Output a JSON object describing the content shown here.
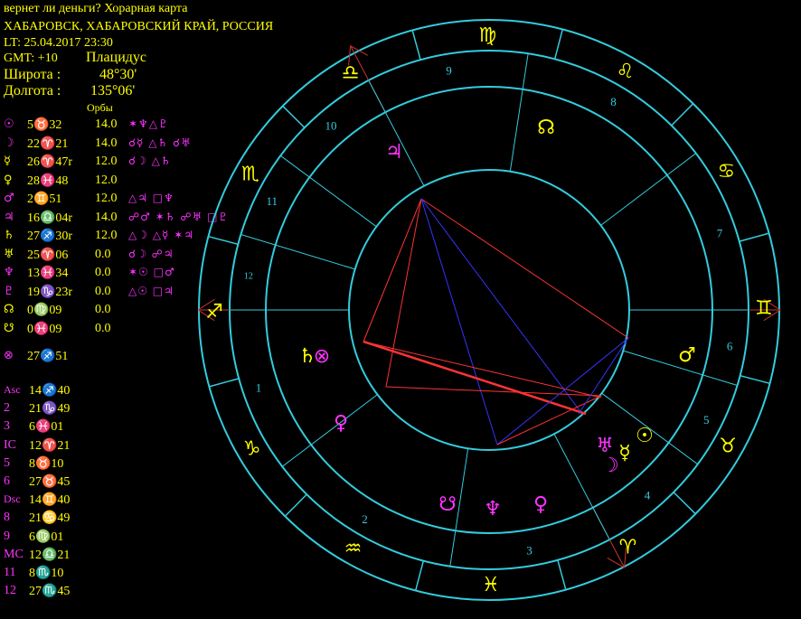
{
  "header": {
    "title": "вернет ли деньги? Хорарная карта",
    "place": "ХАБАРОВСК, ХАБАРОВСКИЙ КРАЙ, РОССИЯ",
    "lt": "LT: 25.04.2017  23:30",
    "gmt": "GMT: +10",
    "system": "Плацидус",
    "lat_label": "Широта :",
    "lat_value": "48°30'",
    "lon_label": "Долгота :",
    "lon_value": "135°06'",
    "orbs_label": "Орбы"
  },
  "planets": [
    {
      "glyph": "☉",
      "color": "#ff33ff",
      "pos": "5♉32",
      "orb": "14.0",
      "aspects": "✶♆△♇"
    },
    {
      "glyph": "☽",
      "color": "#ff33ff",
      "pos": "22♈21",
      "orb": "14.0",
      "aspects": "☌☿ △♄ ☌♅"
    },
    {
      "glyph": "☿",
      "color": "#ffff00",
      "pos": "26♈47r",
      "orb": "12.0",
      "aspects": "☌☽ △♄"
    },
    {
      "glyph": "♀",
      "color": "#ffff00",
      "pos": "28♓48",
      "orb": "12.0",
      "aspects": ""
    },
    {
      "glyph": "♂",
      "color": "#ff33ff",
      "pos": "2♊51",
      "orb": "12.0",
      "aspects": "△♃ □♆"
    },
    {
      "glyph": "♃",
      "color": "#ff33ff",
      "pos": "16♎04r",
      "orb": "14.0",
      "aspects": "☍♂ ✶♄ ☍♅ □♇"
    },
    {
      "glyph": "♄",
      "color": "#ffff00",
      "pos": "27♐30r",
      "orb": "12.0",
      "aspects": "△☽ △☿ ✶♃"
    },
    {
      "glyph": "♅",
      "color": "#ffff00",
      "pos": "25♈06",
      "orb": "0.0",
      "aspects": "☌☽ ☍♃"
    },
    {
      "glyph": "♆",
      "color": "#ff33ff",
      "pos": "13♓34",
      "orb": "0.0",
      "aspects": "✶☉ □♂"
    },
    {
      "glyph": "♇",
      "color": "#ff33ff",
      "pos": "19♑23r",
      "orb": "0.0",
      "aspects": "△☉ □♃"
    },
    {
      "glyph": "☊",
      "color": "#ffff00",
      "pos": "0♍09",
      "orb": "0.0",
      "aspects": ""
    },
    {
      "glyph": "☋",
      "color": "#ffff00",
      "pos": "0♓09",
      "orb": "0.0",
      "aspects": ""
    },
    {
      "glyph": "⊗",
      "color": "#ff33ff",
      "pos": "27♐51",
      "orb": "",
      "aspects": ""
    }
  ],
  "cusps": [
    {
      "label": "Asc",
      "value": "14♐40"
    },
    {
      "label": "2",
      "value": "21♑49"
    },
    {
      "label": "3",
      "value": "6♓01"
    },
    {
      "label": "IC",
      "value": "12♈21"
    },
    {
      "label": "5",
      "value": "8♉10"
    },
    {
      "label": "6",
      "value": "27♉45"
    },
    {
      "label": "Dsc",
      "value": "14♊40"
    },
    {
      "label": "8",
      "value": "21♋49"
    },
    {
      "label": "9",
      "value": "6♍01"
    },
    {
      "label": "MC",
      "value": "12♎21"
    },
    {
      "label": "11",
      "value": "8♏10"
    },
    {
      "label": "12",
      "value": "27♏45"
    }
  ],
  "wheel": {
    "house_numbers": [
      "1",
      "2",
      "3",
      "4",
      "5",
      "6",
      "7",
      "8",
      "9",
      "10",
      "11",
      "12"
    ],
    "zodiac_glyphs": [
      "♐",
      "♑",
      "♒",
      "♓",
      "♈",
      "♉",
      "♊",
      "♋",
      "♌",
      "♍",
      "♎",
      "♏"
    ],
    "inner_planet_glyphs": [
      "♄",
      "⊗",
      "♀",
      "☋",
      "♆",
      "♀",
      "♅",
      "☉",
      "☿",
      "☽",
      "♂",
      "♃",
      "☊"
    ],
    "colors": {
      "circle": "#33ccdd",
      "magenta": "#ff33ff",
      "yellow": "#ffff00",
      "red": "#ff3333",
      "blue": "#3333ff",
      "axis": "#cc3333"
    }
  }
}
